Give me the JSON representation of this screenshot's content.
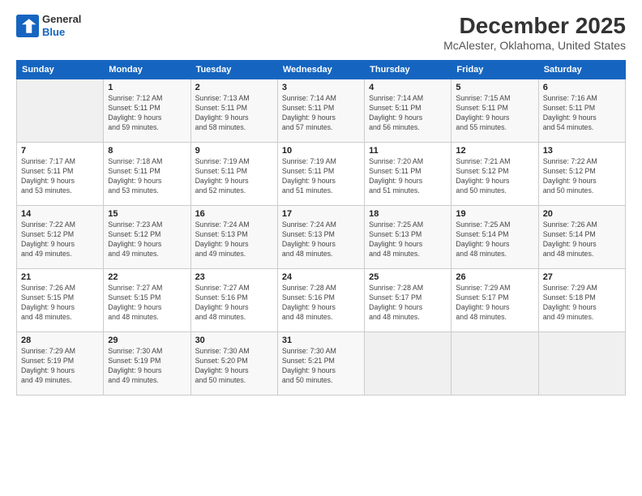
{
  "logo": {
    "line1": "General",
    "line2": "Blue"
  },
  "header": {
    "month": "December 2025",
    "location": "McAlester, Oklahoma, United States"
  },
  "weekdays": [
    "Sunday",
    "Monday",
    "Tuesday",
    "Wednesday",
    "Thursday",
    "Friday",
    "Saturday"
  ],
  "weeks": [
    [
      {
        "day": "",
        "info": ""
      },
      {
        "day": "1",
        "info": "Sunrise: 7:12 AM\nSunset: 5:11 PM\nDaylight: 9 hours\nand 59 minutes."
      },
      {
        "day": "2",
        "info": "Sunrise: 7:13 AM\nSunset: 5:11 PM\nDaylight: 9 hours\nand 58 minutes."
      },
      {
        "day": "3",
        "info": "Sunrise: 7:14 AM\nSunset: 5:11 PM\nDaylight: 9 hours\nand 57 minutes."
      },
      {
        "day": "4",
        "info": "Sunrise: 7:14 AM\nSunset: 5:11 PM\nDaylight: 9 hours\nand 56 minutes."
      },
      {
        "day": "5",
        "info": "Sunrise: 7:15 AM\nSunset: 5:11 PM\nDaylight: 9 hours\nand 55 minutes."
      },
      {
        "day": "6",
        "info": "Sunrise: 7:16 AM\nSunset: 5:11 PM\nDaylight: 9 hours\nand 54 minutes."
      }
    ],
    [
      {
        "day": "7",
        "info": "Sunrise: 7:17 AM\nSunset: 5:11 PM\nDaylight: 9 hours\nand 53 minutes."
      },
      {
        "day": "8",
        "info": "Sunrise: 7:18 AM\nSunset: 5:11 PM\nDaylight: 9 hours\nand 53 minutes."
      },
      {
        "day": "9",
        "info": "Sunrise: 7:19 AM\nSunset: 5:11 PM\nDaylight: 9 hours\nand 52 minutes."
      },
      {
        "day": "10",
        "info": "Sunrise: 7:19 AM\nSunset: 5:11 PM\nDaylight: 9 hours\nand 51 minutes."
      },
      {
        "day": "11",
        "info": "Sunrise: 7:20 AM\nSunset: 5:11 PM\nDaylight: 9 hours\nand 51 minutes."
      },
      {
        "day": "12",
        "info": "Sunrise: 7:21 AM\nSunset: 5:12 PM\nDaylight: 9 hours\nand 50 minutes."
      },
      {
        "day": "13",
        "info": "Sunrise: 7:22 AM\nSunset: 5:12 PM\nDaylight: 9 hours\nand 50 minutes."
      }
    ],
    [
      {
        "day": "14",
        "info": "Sunrise: 7:22 AM\nSunset: 5:12 PM\nDaylight: 9 hours\nand 49 minutes."
      },
      {
        "day": "15",
        "info": "Sunrise: 7:23 AM\nSunset: 5:12 PM\nDaylight: 9 hours\nand 49 minutes."
      },
      {
        "day": "16",
        "info": "Sunrise: 7:24 AM\nSunset: 5:13 PM\nDaylight: 9 hours\nand 49 minutes."
      },
      {
        "day": "17",
        "info": "Sunrise: 7:24 AM\nSunset: 5:13 PM\nDaylight: 9 hours\nand 48 minutes."
      },
      {
        "day": "18",
        "info": "Sunrise: 7:25 AM\nSunset: 5:13 PM\nDaylight: 9 hours\nand 48 minutes."
      },
      {
        "day": "19",
        "info": "Sunrise: 7:25 AM\nSunset: 5:14 PM\nDaylight: 9 hours\nand 48 minutes."
      },
      {
        "day": "20",
        "info": "Sunrise: 7:26 AM\nSunset: 5:14 PM\nDaylight: 9 hours\nand 48 minutes."
      }
    ],
    [
      {
        "day": "21",
        "info": "Sunrise: 7:26 AM\nSunset: 5:15 PM\nDaylight: 9 hours\nand 48 minutes."
      },
      {
        "day": "22",
        "info": "Sunrise: 7:27 AM\nSunset: 5:15 PM\nDaylight: 9 hours\nand 48 minutes."
      },
      {
        "day": "23",
        "info": "Sunrise: 7:27 AM\nSunset: 5:16 PM\nDaylight: 9 hours\nand 48 minutes."
      },
      {
        "day": "24",
        "info": "Sunrise: 7:28 AM\nSunset: 5:16 PM\nDaylight: 9 hours\nand 48 minutes."
      },
      {
        "day": "25",
        "info": "Sunrise: 7:28 AM\nSunset: 5:17 PM\nDaylight: 9 hours\nand 48 minutes."
      },
      {
        "day": "26",
        "info": "Sunrise: 7:29 AM\nSunset: 5:17 PM\nDaylight: 9 hours\nand 48 minutes."
      },
      {
        "day": "27",
        "info": "Sunrise: 7:29 AM\nSunset: 5:18 PM\nDaylight: 9 hours\nand 49 minutes."
      }
    ],
    [
      {
        "day": "28",
        "info": "Sunrise: 7:29 AM\nSunset: 5:19 PM\nDaylight: 9 hours\nand 49 minutes."
      },
      {
        "day": "29",
        "info": "Sunrise: 7:30 AM\nSunset: 5:19 PM\nDaylight: 9 hours\nand 49 minutes."
      },
      {
        "day": "30",
        "info": "Sunrise: 7:30 AM\nSunset: 5:20 PM\nDaylight: 9 hours\nand 50 minutes."
      },
      {
        "day": "31",
        "info": "Sunrise: 7:30 AM\nSunset: 5:21 PM\nDaylight: 9 hours\nand 50 minutes."
      },
      {
        "day": "",
        "info": ""
      },
      {
        "day": "",
        "info": ""
      },
      {
        "day": "",
        "info": ""
      }
    ]
  ]
}
